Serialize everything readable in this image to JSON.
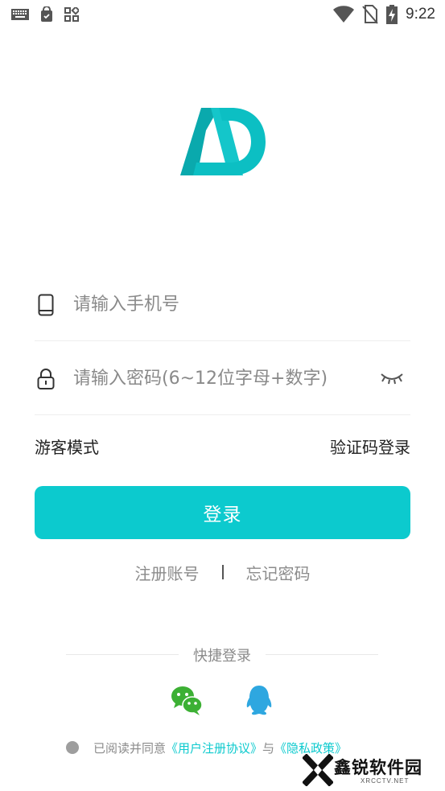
{
  "status_bar": {
    "time": "9:22",
    "icons": [
      "keyboard-icon",
      "shopping-bag-icon",
      "apps-grid-icon",
      "wifi-icon",
      "no-sim-icon",
      "battery-charging-icon"
    ]
  },
  "logo": {
    "name": "AD-logo",
    "color": "#0ccace"
  },
  "form": {
    "phone_placeholder": "请输入手机号",
    "password_placeholder": "请输入密码(6~12位字母+数字)"
  },
  "links": {
    "guest_mode": "游客模式",
    "sms_login": "验证码登录",
    "register": "注册账号",
    "forgot": "忘记密码"
  },
  "login_button": "登录",
  "quick_login": {
    "label": "快捷登录",
    "providers": [
      "wechat-icon",
      "qq-icon"
    ]
  },
  "agreement": {
    "prefix": "已阅读并同意",
    "user_agreement": "《用户注册协议》",
    "and": "与",
    "privacy": "《隐私政策》"
  },
  "watermark": {
    "title": "鑫锐软件园",
    "subtitle": "XRCCTV.NET"
  },
  "colors": {
    "accent": "#0ccace",
    "muted": "#8b8b8b",
    "wechat": "#3cb034",
    "qq": "#2ea7e0"
  }
}
